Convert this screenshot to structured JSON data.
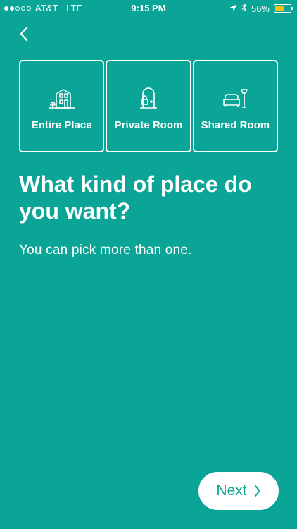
{
  "status_bar": {
    "carrier": "AT&T",
    "network": "LTE",
    "time": "9:15 PM",
    "battery_percent_label": "56%",
    "battery_level": 0.56,
    "signal_bars_filled": 2,
    "signal_bars_total": 5,
    "icons": [
      "location-arrow-icon",
      "bluetooth-icon",
      "battery-icon"
    ]
  },
  "nav": {
    "back_icon": "chevron-left-icon"
  },
  "options": [
    {
      "label": "Entire Place",
      "icon": "house-icon"
    },
    {
      "label": "Private Room",
      "icon": "door-lock-icon"
    },
    {
      "label": "Shared Room",
      "icon": "couch-lamp-icon"
    }
  ],
  "main": {
    "heading": "What kind of place do you want?",
    "subtext": "You can pick more than one."
  },
  "footer": {
    "next_label": "Next",
    "next_icon": "chevron-right-icon"
  },
  "colors": {
    "background": "#0aa596",
    "foreground": "#ffffff",
    "battery": "#f2c10f"
  }
}
